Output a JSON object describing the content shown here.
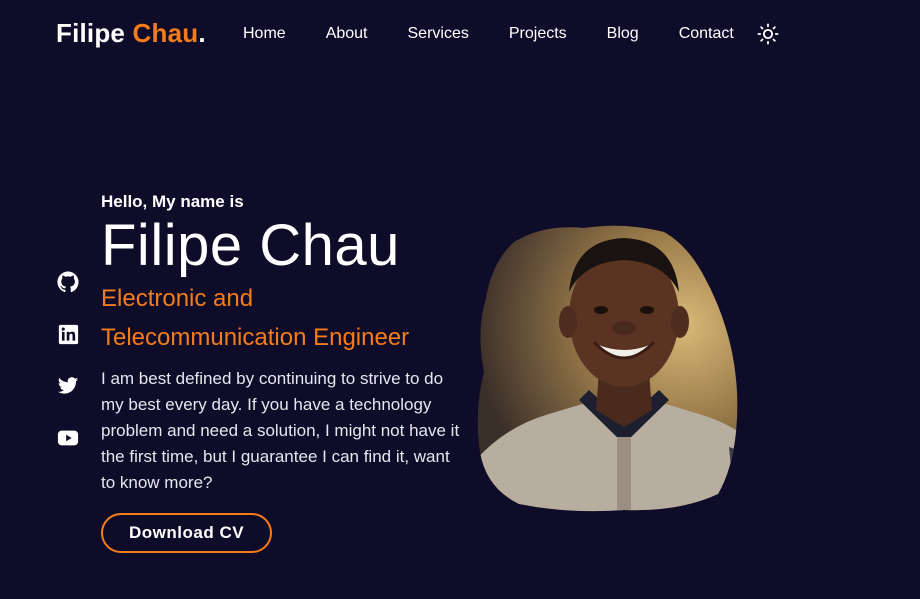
{
  "header": {
    "logo_first": "Filipe",
    "logo_second": "Chau",
    "logo_dot": ".",
    "nav": [
      "Home",
      "About",
      "Services",
      "Projects",
      "Blog",
      "Contact"
    ],
    "theme_icon": "sun-icon"
  },
  "social": [
    "github-icon",
    "linkedin-icon",
    "twitter-icon",
    "youtube-icon"
  ],
  "hero": {
    "greeting": "Hello, My name is",
    "name": "Filipe Chau",
    "role_line1": "Electronic and",
    "role_line2": "Telecommunication Engineer",
    "bio": "I am best defined by continuing to strive to do my best every day. If you have a technology problem and need a solution, I might not have it the first time, but I guarantee I can find it, want to know more?",
    "cta": "Download CV"
  },
  "colors": {
    "background": "#0f0c29",
    "accent": "#f47c1a",
    "text": "#ffffff"
  }
}
